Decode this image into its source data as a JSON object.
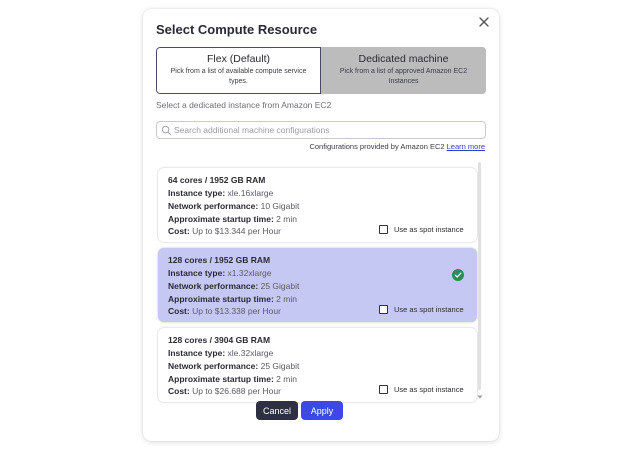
{
  "dialog": {
    "title": "Select Compute Resource",
    "close_icon": "close-icon"
  },
  "mode_toggle": {
    "options": [
      {
        "title": "Flex (Default)",
        "description": "Pick from a list of available compute service types.",
        "active": true
      },
      {
        "title": "Dedicated machine",
        "description": "Pick from a list of approved Amazon EC2 Instances",
        "active": false
      }
    ]
  },
  "subtitle": "Select a dedicated instance from Amazon EC2",
  "search": {
    "placeholder": "Search additional machine configurations",
    "value": "",
    "icon": "search-icon"
  },
  "provided_by": {
    "text": "Configurations provided by Amazon EC2",
    "link": "Learn more"
  },
  "labels": {
    "instance_type": "Instance type:",
    "network": "Network performance:",
    "startup": "Approximate startup time:",
    "cost": "Cost:",
    "spot": "Use as spot instance"
  },
  "instances": [
    {
      "title": "64 cores / 1952 GB RAM",
      "instance_type": "xle.16xlarge",
      "network": "10 Gigabit",
      "startup": "2 min",
      "cost": "Up to $13.344 per Hour",
      "selected": false,
      "spot": false
    },
    {
      "title": "128 cores / 1952 GB RAM",
      "instance_type": "x1.32xlarge",
      "network": "25 Gigabit",
      "startup": "2 min",
      "cost": "Up to $13.338 per Hour",
      "selected": true,
      "spot": false
    },
    {
      "title": "128 cores / 3904 GB RAM",
      "instance_type": "xle.32xlarge",
      "network": "25 Gigabit",
      "startup": "2 min",
      "cost": "Up to $26.688 per Hour",
      "selected": false,
      "spot": false
    }
  ],
  "buttons": {
    "cancel": "Cancel",
    "apply": "Apply"
  },
  "colors": {
    "selected_card": "#c6c8f4",
    "apply": "#4047e8",
    "cancel": "#2d3040",
    "check": "#2e8b57"
  }
}
